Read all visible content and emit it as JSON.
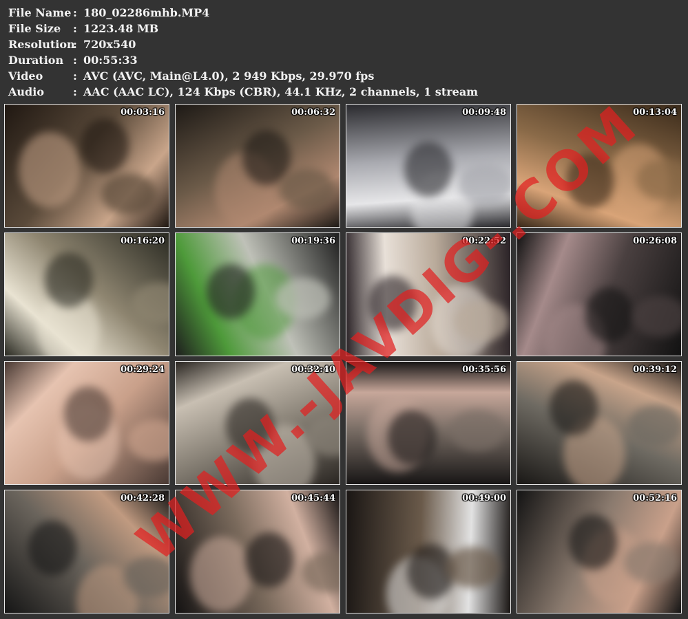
{
  "file_info": [
    {
      "label": "File Name",
      "value": "180_02286mhb.MP4"
    },
    {
      "label": "File Size",
      "value": "1223.48 MB"
    },
    {
      "label": "Resolution",
      "value": "720x540"
    },
    {
      "label": "Duration",
      "value": "00:55:33"
    },
    {
      "label": "Video",
      "value": "AVC (AVC, Main@L4.0), 2 949 Kbps, 29.970 fps"
    },
    {
      "label": "Audio",
      "value": "AAC (AAC LC), 124 Kbps (CBR), 44.1 KHz, 2 channels, 1 stream"
    }
  ],
  "thumbnails": [
    {
      "time": "00:03:16",
      "base": "#5a4a3a",
      "accent": "#c9a58a",
      "dark": "#201812"
    },
    {
      "time": "00:06:32",
      "base": "#6b5a48",
      "accent": "#b08870",
      "dark": "#1e1a16"
    },
    {
      "time": "00:09:48",
      "base": "#a9aab0",
      "accent": "#e6e6e8",
      "dark": "#2a2a2e"
    },
    {
      "time": "00:13:04",
      "base": "#8a6a48",
      "accent": "#d9a478",
      "dark": "#3a2a1a"
    },
    {
      "time": "00:16:20",
      "base": "#8e8570",
      "accent": "#e9e3d2",
      "dark": "#2a2a22"
    },
    {
      "time": "00:19:36",
      "base": "#bfc1b8",
      "accent": "#4e9a3a",
      "dark": "#1e1e1e"
    },
    {
      "time": "00:22:52",
      "base": "#b9aa9a",
      "accent": "#e8e0d8",
      "dark": "#2a2226"
    },
    {
      "time": "00:26:08",
      "base": "#4a4040",
      "accent": "#a58a8a",
      "dark": "#121212"
    },
    {
      "time": "00:29:24",
      "base": "#c9a08a",
      "accent": "#e6c3b0",
      "dark": "#4a3a34"
    },
    {
      "time": "00:32:40",
      "base": "#8a8378",
      "accent": "#c8bfb2",
      "dark": "#2a2622"
    },
    {
      "time": "00:35:56",
      "base": "#7a6e66",
      "accent": "#c7a79a",
      "dark": "#181616"
    },
    {
      "time": "00:39:12",
      "base": "#6e6a62",
      "accent": "#c8a48a",
      "dark": "#1a1816"
    },
    {
      "time": "00:42:28",
      "base": "#6a645c",
      "accent": "#c09a80",
      "dark": "#161616"
    },
    {
      "time": "00:45:44",
      "base": "#7a6a5c",
      "accent": "#d1b0a0",
      "dark": "#141212"
    },
    {
      "time": "00:49:00",
      "base": "#6a5a4a",
      "accent": "#e2e2e2",
      "dark": "#1a1614"
    },
    {
      "time": "00:52:16",
      "base": "#8a7a6e",
      "accent": "#c9a08a",
      "dark": "#141414"
    }
  ],
  "watermark": {
    "text": "WWW.-JAVDIG-.COM",
    "color": "#e02020"
  }
}
